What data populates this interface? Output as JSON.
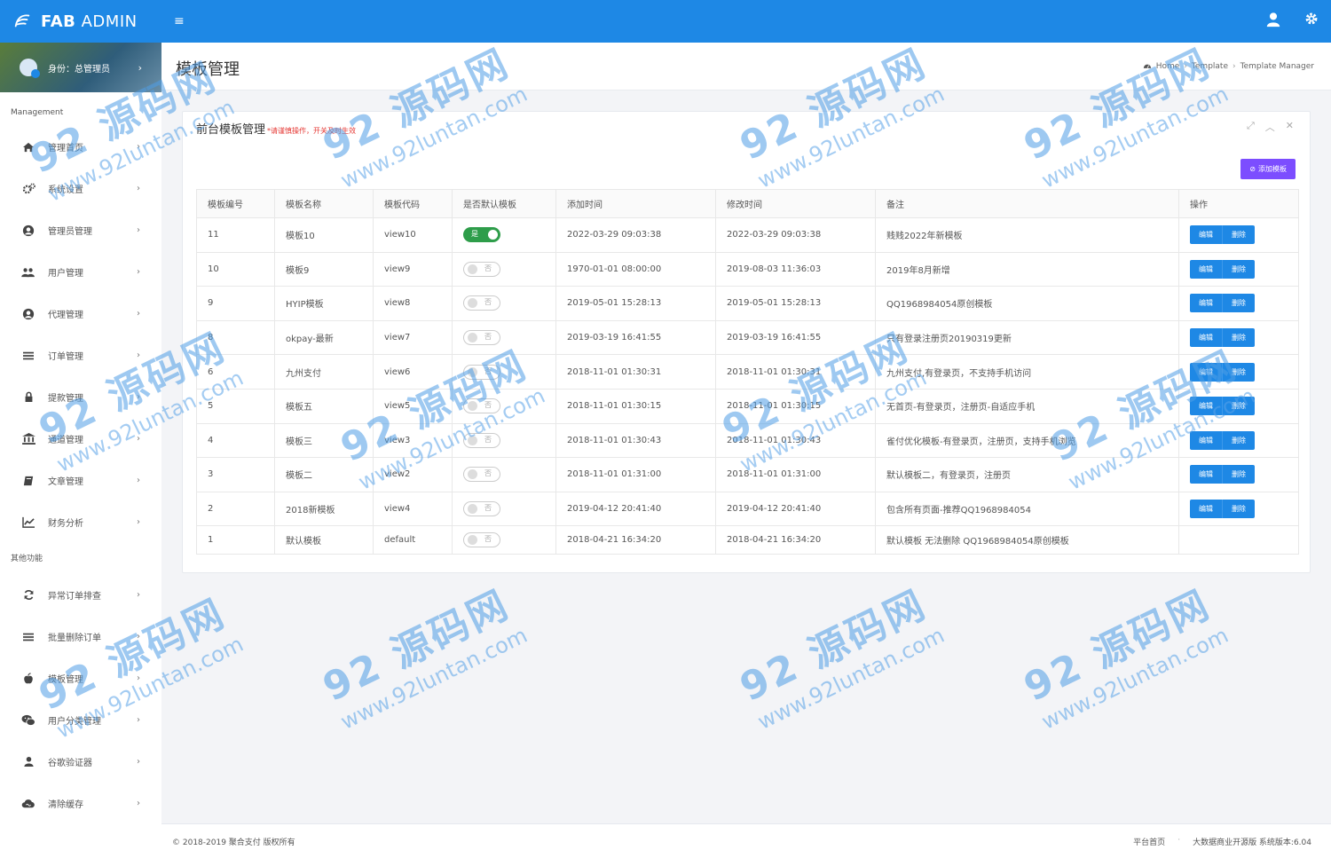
{
  "brand": {
    "name_bold": "FAB",
    "name_rest": " ADMIN"
  },
  "user": {
    "role": "身份：总管理员"
  },
  "sidebar": {
    "section1": "Management",
    "items1": [
      {
        "label": "管理首页",
        "icon": "home-icon"
      },
      {
        "label": "系统设置",
        "icon": "gears-icon"
      },
      {
        "label": "管理员管理",
        "icon": "user-circle-icon"
      },
      {
        "label": "用户管理",
        "icon": "users-icon"
      },
      {
        "label": "代理管理",
        "icon": "user-circle-icon"
      },
      {
        "label": "订单管理",
        "icon": "list-icon"
      },
      {
        "label": "提款管理",
        "icon": "lock-icon"
      },
      {
        "label": "通道管理",
        "icon": "bank-icon"
      },
      {
        "label": "文章管理",
        "icon": "book-icon"
      },
      {
        "label": "财务分析",
        "icon": "line-chart-icon"
      }
    ],
    "section2": "其他功能",
    "items2": [
      {
        "label": "异常订单排查",
        "icon": "refresh-icon"
      },
      {
        "label": "批量删除订单",
        "icon": "list-icon"
      },
      {
        "label": "模板管理",
        "icon": "apple-icon"
      },
      {
        "label": "用户分类管理",
        "icon": "wechat-icon"
      },
      {
        "label": "谷歌验证器",
        "icon": "user-icon"
      },
      {
        "label": "清除缓存",
        "icon": "cloud-icon"
      }
    ]
  },
  "page": {
    "title": "模板管理",
    "breadcrumb": [
      "Home",
      "Template",
      "Template Manager"
    ]
  },
  "card": {
    "title": "前台模板管理",
    "warning": "*请谨慎操作，开关及时生效",
    "add_button": "添加模板"
  },
  "table": {
    "headers": [
      "模板编号",
      "模板名称",
      "模板代码",
      "是否默认模板",
      "添加时间",
      "修改时间",
      "备注",
      "操作"
    ],
    "rows": [
      {
        "id": "11",
        "name": "模板10",
        "code": "view10",
        "default": "是",
        "is_default": true,
        "added": "2022-03-29 09:03:38",
        "modified": "2022-03-29 09:03:38",
        "note": "贱贱2022年新模板",
        "edit": "编辑",
        "delete": "删除"
      },
      {
        "id": "10",
        "name": "模板9",
        "code": "view9",
        "default": "否",
        "is_default": false,
        "added": "1970-01-01 08:00:00",
        "modified": "2019-08-03 11:36:03",
        "note": "2019年8月新增",
        "edit": "编辑",
        "delete": "删除"
      },
      {
        "id": "9",
        "name": "HYIP模板",
        "code": "view8",
        "default": "否",
        "is_default": false,
        "added": "2019-05-01 15:28:13",
        "modified": "2019-05-01 15:28:13",
        "note": "QQ1968984054原创模板",
        "edit": "编辑",
        "delete": "删除"
      },
      {
        "id": "8",
        "name": "okpay-最新",
        "code": "view7",
        "default": "否",
        "is_default": false,
        "added": "2019-03-19 16:41:55",
        "modified": "2019-03-19 16:41:55",
        "note": "只有登录注册页20190319更新",
        "edit": "编辑",
        "delete": "删除"
      },
      {
        "id": "6",
        "name": "九州支付",
        "code": "view6",
        "default": "否",
        "is_default": false,
        "added": "2018-11-01 01:30:31",
        "modified": "2018-11-01 01:30:31",
        "note": "九州支付,有登录页，不支持手机访问",
        "edit": "编辑",
        "delete": "删除"
      },
      {
        "id": "5",
        "name": "模板五",
        "code": "view5",
        "default": "否",
        "is_default": false,
        "added": "2018-11-01 01:30:15",
        "modified": "2018-11-01 01:30:15",
        "note": "无首页-有登录页，注册页-自适应手机",
        "edit": "编辑",
        "delete": "删除"
      },
      {
        "id": "4",
        "name": "模板三",
        "code": "view3",
        "default": "否",
        "is_default": false,
        "added": "2018-11-01 01:30:43",
        "modified": "2018-11-01 01:30:43",
        "note": "雀付优化模板-有登录页，注册页，支持手机浏览",
        "edit": "编辑",
        "delete": "删除"
      },
      {
        "id": "3",
        "name": "模板二",
        "code": "view2",
        "default": "否",
        "is_default": false,
        "added": "2018-11-01 01:31:00",
        "modified": "2018-11-01 01:31:00",
        "note": "默认模板二，有登录页，注册页",
        "edit": "编辑",
        "delete": "删除"
      },
      {
        "id": "2",
        "name": "2018新模板",
        "code": "view4",
        "default": "否",
        "is_default": false,
        "added": "2019-04-12 20:41:40",
        "modified": "2019-04-12 20:41:40",
        "note": "包含所有页面-推荐QQ1968984054",
        "edit": "编辑",
        "delete": "删除"
      },
      {
        "id": "1",
        "name": "默认模板",
        "code": "default",
        "default": "否",
        "is_default": false,
        "added": "2018-04-21 16:34:20",
        "modified": "2018-04-21 16:34:20",
        "note": "默认模板 无法删除 QQ1968984054原创模板",
        "edit": "",
        "delete": ""
      }
    ]
  },
  "footer": {
    "copyright": "© 2018-2019 聚合支付 版权所有",
    "link1": "平台首页",
    "dot": "·",
    "version": "大数据商业开源版 系统版本:6.04"
  },
  "watermark": {
    "brand": "92 源码网",
    "url": "www.92luntan.com"
  },
  "colors": {
    "primary": "#1e88e5",
    "purple": "#7c4dff",
    "toggle_on": "#2e9d4a",
    "warning": "#e53935"
  }
}
